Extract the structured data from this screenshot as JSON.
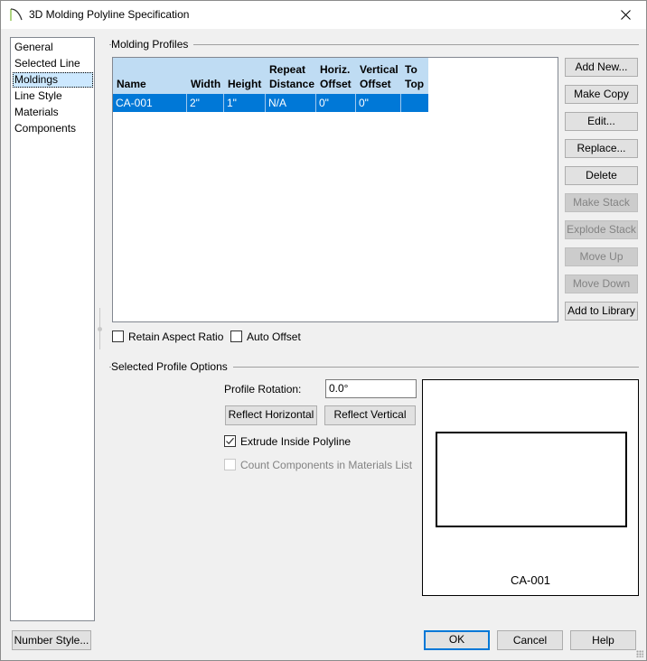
{
  "window": {
    "title": "3D Molding Polyline Specification",
    "close_icon": "close-x-icon",
    "app_icon": "molding-profile-icon"
  },
  "sidebar": {
    "items": [
      {
        "label": "General",
        "selected": false
      },
      {
        "label": "Selected Line",
        "selected": false
      },
      {
        "label": "Moldings",
        "selected": true
      },
      {
        "label": "Line Style",
        "selected": false
      },
      {
        "label": "Materials",
        "selected": false
      },
      {
        "label": "Components",
        "selected": false
      }
    ]
  },
  "molding_profiles": {
    "group_label": "Molding Profiles",
    "columns": [
      {
        "line1": "",
        "line2": "Name"
      },
      {
        "line1": "",
        "line2": "Width"
      },
      {
        "line1": "",
        "line2": "Height"
      },
      {
        "line1": "Repeat",
        "line2": "Distance"
      },
      {
        "line1": "Horiz.",
        "line2": "Offset"
      },
      {
        "line1": "Vertical",
        "line2": "Offset"
      },
      {
        "line1": "To",
        "line2": "Top"
      }
    ],
    "rows": [
      {
        "cells": [
          "CA-001",
          "2\"",
          "1\"",
          "N/A",
          "0\"",
          "0\"",
          ""
        ],
        "selected": true
      }
    ],
    "buttons": [
      {
        "label": "Add New...",
        "enabled": true
      },
      {
        "label": "Make Copy",
        "enabled": true
      },
      {
        "label": "Edit...",
        "enabled": true
      },
      {
        "label": "Replace...",
        "enabled": true
      },
      {
        "label": "Delete",
        "enabled": true
      },
      {
        "label": "Make Stack",
        "enabled": false
      },
      {
        "label": "Explode Stack",
        "enabled": false
      },
      {
        "label": "Move Up",
        "enabled": false
      },
      {
        "label": "Move Down",
        "enabled": false
      },
      {
        "label": "Add to Library",
        "enabled": true
      }
    ],
    "retain_aspect_ratio": {
      "label": "Retain Aspect Ratio",
      "checked": false
    },
    "auto_offset": {
      "label": "Auto Offset",
      "checked": false
    }
  },
  "selected_profile_options": {
    "group_label": "Selected Profile Options",
    "profile_rotation_label": "Profile Rotation:",
    "profile_rotation_value": "0.0°",
    "reflect_horizontal_label": "Reflect Horizontal",
    "reflect_vertical_label": "Reflect Vertical",
    "extrude_inside": {
      "label": "Extrude Inside Polyline",
      "checked": true,
      "enabled": true
    },
    "count_components": {
      "label": "Count Components in Materials List",
      "checked": false,
      "enabled": false
    },
    "preview_label": "CA-001"
  },
  "footer": {
    "number_style_label": "Number Style...",
    "ok_label": "OK",
    "cancel_label": "Cancel",
    "help_label": "Help"
  }
}
